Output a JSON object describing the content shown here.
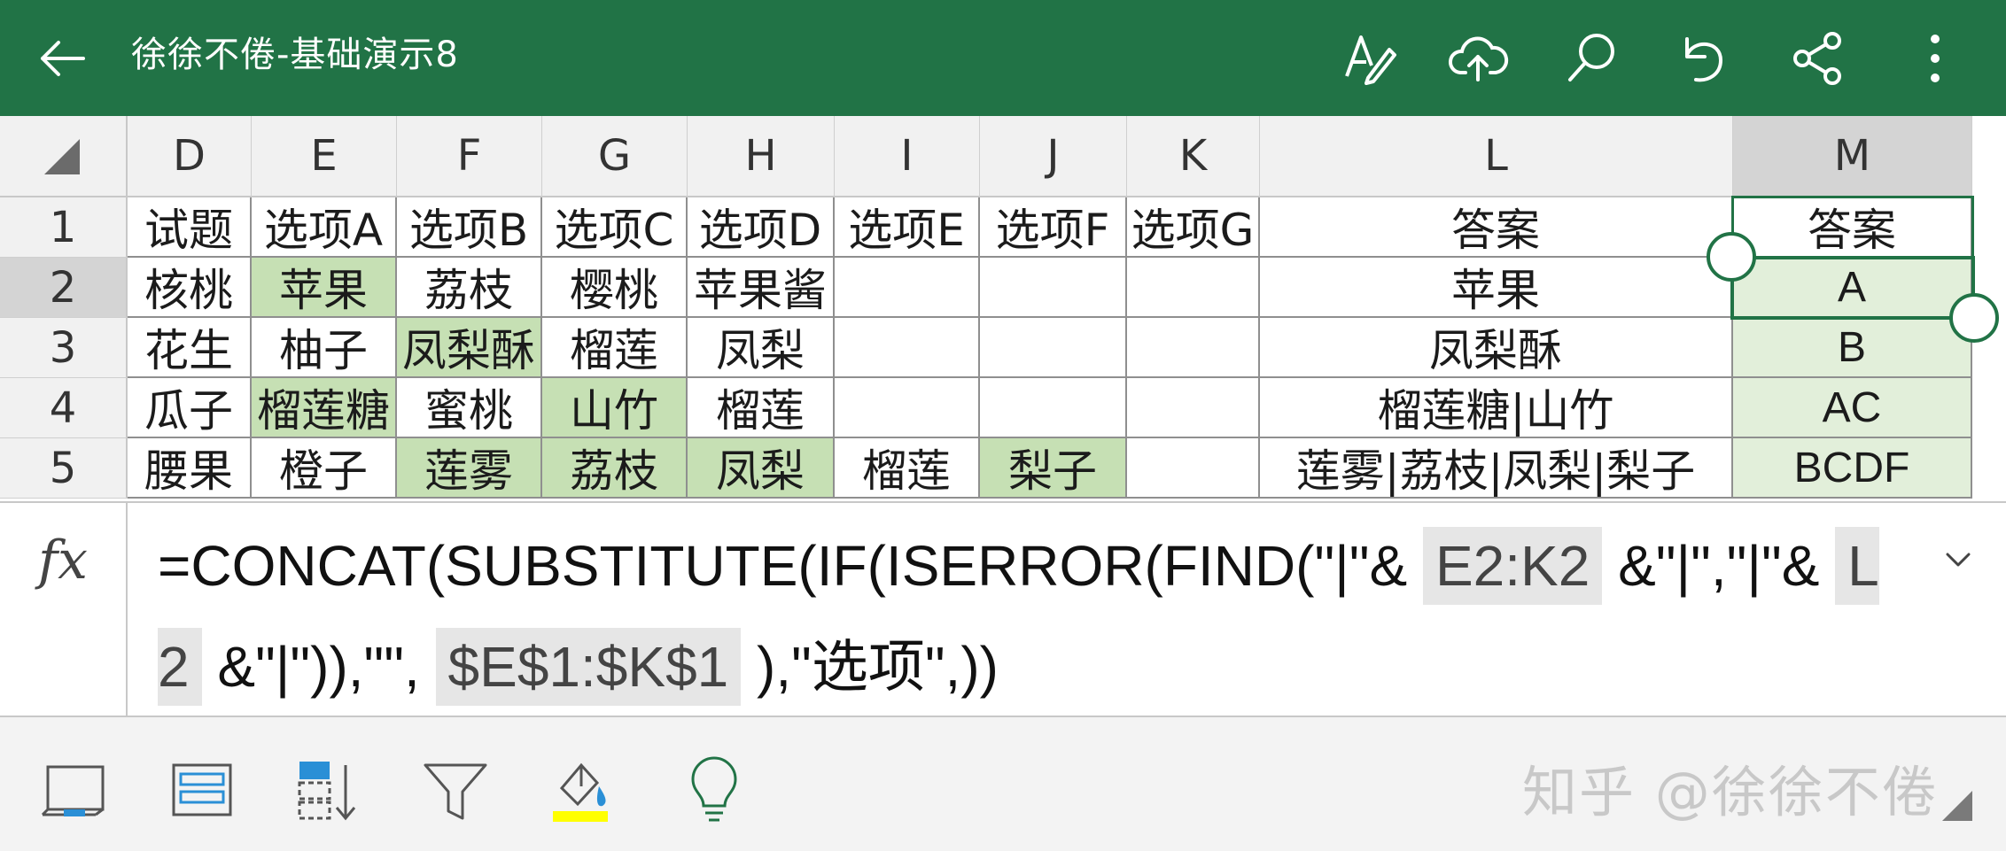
{
  "header": {
    "title": "徐徐不倦-基础演示8",
    "icons": [
      "back-arrow-icon",
      "draw-pen-icon",
      "cloud-upload-icon",
      "search-icon",
      "undo-icon",
      "share-icon",
      "more-vertical-icon"
    ],
    "background_color": "#217346"
  },
  "columns": [
    "D",
    "E",
    "F",
    "G",
    "H",
    "I",
    "J",
    "K",
    "L",
    "M"
  ],
  "selected_column": "M",
  "rows": [
    "1",
    "2",
    "3",
    "4",
    "5"
  ],
  "selected_row": "2",
  "table": {
    "header_row": [
      "试题",
      "选项A",
      "选项B",
      "选项C",
      "选项D",
      "选项E",
      "选项F",
      "选项G",
      "答案",
      "答案"
    ],
    "data_rows": [
      [
        "核桃",
        "苹果",
        "荔枝",
        "樱桃",
        "苹果酱",
        "",
        "",
        "",
        "苹果",
        "A"
      ],
      [
        "花生",
        "柚子",
        "凤梨酥",
        "榴莲",
        "凤梨",
        "",
        "",
        "",
        "凤梨酥",
        "B"
      ],
      [
        "瓜子",
        "榴莲糖",
        "蜜桃",
        "山竹",
        "榴莲",
        "",
        "",
        "",
        "榴莲糖|山竹",
        "AC"
      ],
      [
        "腰果",
        "橙子",
        "莲雾",
        "荔枝",
        "凤梨",
        "榴莲",
        "梨子",
        "",
        "莲雾|荔枝|凤梨|梨子",
        "BCDF"
      ]
    ],
    "highlighted_cells": [
      "E2",
      "F3",
      "E4",
      "G4",
      "F5",
      "G5",
      "H5",
      "J5"
    ],
    "highlight_color": "#c6e0b4"
  },
  "selected_cell": "M2",
  "formula_bar": {
    "fx_label": "fx",
    "parts": [
      {
        "text": "=CONCAT(SUBSTITUTE(IF(ISERROR(FIND(\"|\"& ",
        "ref": false
      },
      {
        "text": "E2:K2",
        "ref": true
      },
      {
        "text": " &\"|\",\"|\"& ",
        "ref": false
      },
      {
        "text": "L2",
        "ref": true
      },
      {
        "text": " &\"|\")),\"\", ",
        "ref": false
      },
      {
        "text": "$E$1:$K$1",
        "ref": true
      },
      {
        "text": " ),\"选项\",))",
        "ref": false
      }
    ],
    "expand_icon": "chevron-down-icon"
  },
  "toolbar": {
    "icons": [
      "freeze-panes-icon",
      "table-format-icon",
      "sort-icon",
      "filter-icon",
      "fill-color-icon",
      "tell-me-lightbulb-icon"
    ],
    "fill_color_swatch": "#ffff00",
    "watermark": "知乎 @徐徐不倦"
  }
}
